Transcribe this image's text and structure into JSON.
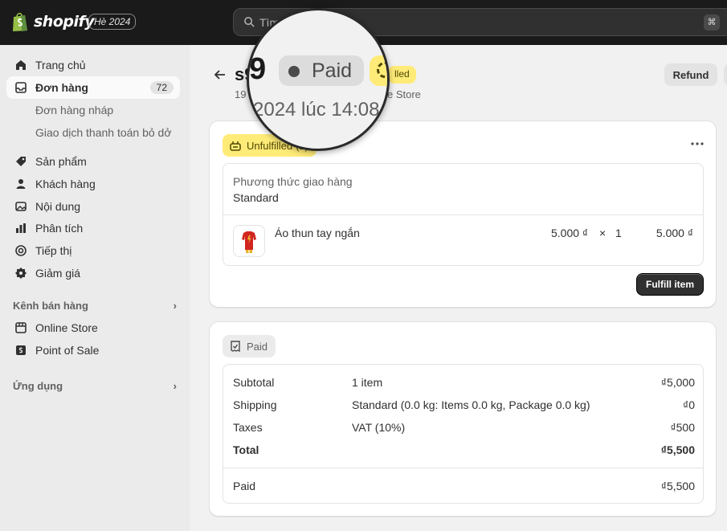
{
  "topbar": {
    "brand": "shopify",
    "edition": "Hè 2024",
    "search_placeholder": "Tìm",
    "shortcut": "⌘"
  },
  "sidebar": {
    "items": [
      {
        "label": "Trang chủ",
        "icon": "home-icon"
      },
      {
        "label": "Đơn hàng",
        "icon": "inbox-icon",
        "count": "72",
        "active": true
      },
      {
        "label": "Sản phẩm",
        "icon": "tag-icon"
      },
      {
        "label": "Khách hàng",
        "icon": "person-icon"
      },
      {
        "label": "Nội dung",
        "icon": "image-icon"
      },
      {
        "label": "Phân tích",
        "icon": "bar-chart-icon"
      },
      {
        "label": "Tiếp thị",
        "icon": "target-icon"
      },
      {
        "label": "Giảm giá",
        "icon": "discount-icon"
      }
    ],
    "subitems": [
      "Đơn hàng nháp",
      "Giao dịch thanh toán bỏ dở"
    ],
    "sales_channels_heading": "Kênh bán hàng",
    "channels": [
      {
        "label": "Online Store",
        "icon": "store-icon"
      },
      {
        "label": "Point of Sale",
        "icon": "pos-icon"
      }
    ],
    "apps_heading": "Ứng dụng"
  },
  "header": {
    "order_title": "s9",
    "subline": "19 t",
    "subline_right": "e Store",
    "partial_pill": "lled",
    "refund_label": "Refund"
  },
  "magnifier": {
    "number": "9",
    "paid": "Paid",
    "date": "2024 lúc 14:08"
  },
  "fulfillment": {
    "status": "Unfulfilled",
    "status_suffix": "(1)",
    "shipping_label": "Phương thức giao hàng",
    "shipping_value": "Standard",
    "item_name": "Áo thun tay ngắn",
    "item_price": "5.000 ₫",
    "times": "×",
    "quantity": "1",
    "item_total": "5.000 ₫",
    "fulfill_button": "Fulfill item"
  },
  "payment": {
    "status": "Paid",
    "rows": [
      {
        "label": "Subtotal",
        "detail": "1 item",
        "amount": "₫5,000"
      },
      {
        "label": "Shipping",
        "detail": "Standard (0.0 kg: Items 0.0 kg, Package 0.0 kg)",
        "amount": "₫0"
      },
      {
        "label": "Taxes",
        "detail": "VAT (10%)",
        "amount": "₫500"
      },
      {
        "label": "Total",
        "detail": "",
        "amount": "₫5,500"
      }
    ],
    "paid_label": "Paid",
    "paid_amount": "₫5,500"
  },
  "colors": {
    "topbar": "#1a1a1a",
    "sidebar": "#ebebeb",
    "unfulfilled_badge": "#ffeb78",
    "primary_button": "#303030"
  }
}
